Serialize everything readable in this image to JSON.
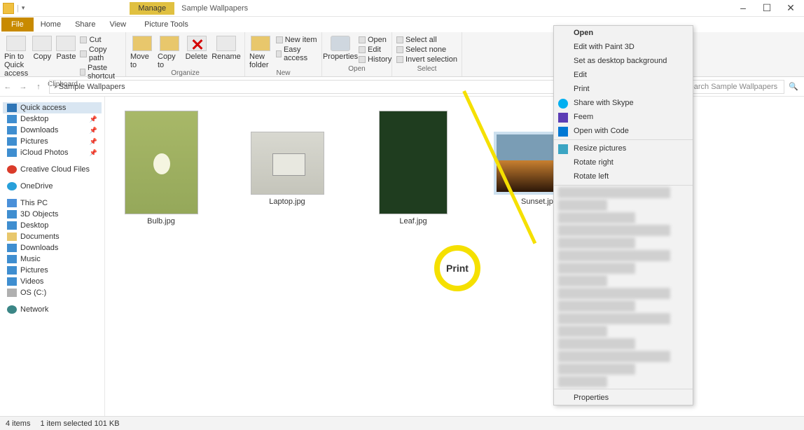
{
  "window": {
    "title_tab": "Manage",
    "title": "Sample Wallpapers",
    "min": "–",
    "max": "☐",
    "close": "✕"
  },
  "tabs": {
    "file": "File",
    "home": "Home",
    "share": "Share",
    "view": "View",
    "picture_tools": "Picture Tools"
  },
  "ribbon": {
    "pin": "Pin to Quick access",
    "copy": "Copy",
    "paste": "Paste",
    "cut": "Cut",
    "copypath": "Copy path",
    "pasteshortcut": "Paste shortcut",
    "clipboard_label": "Clipboard",
    "moveto": "Move to",
    "copyto": "Copy to",
    "delete": "Delete",
    "rename": "Rename",
    "organize_label": "Organize",
    "newfolder": "New folder",
    "newitem": "New item",
    "easyaccess": "Easy access",
    "new_label": "New",
    "properties": "Properties",
    "open": "Open",
    "edit": "Edit",
    "history": "History",
    "open_label": "Open",
    "selectall": "Select all",
    "selectnone": "Select none",
    "invert": "Invert selection",
    "select_label": "Select"
  },
  "address": {
    "back": "←",
    "fwd": "→",
    "up": "↑",
    "path": "› Sample Wallpapers",
    "search_placeholder": "Search Sample Wallpapers",
    "search_glyph": "🔍"
  },
  "sidebar": {
    "quick_access": "Quick access",
    "desktop": "Desktop",
    "downloads": "Downloads",
    "pictures": "Pictures",
    "icloud": "iCloud Photos",
    "creative": "Creative Cloud Files",
    "onedrive": "OneDrive",
    "thispc": "This PC",
    "objects3d": "3D Objects",
    "desktop2": "Desktop",
    "documents": "Documents",
    "downloads2": "Downloads",
    "music": "Music",
    "pictures2": "Pictures",
    "videos": "Videos",
    "osc": "OS (C:)",
    "network": "Network",
    "pin": "📌"
  },
  "files": [
    {
      "name": "Bulb.jpg"
    },
    {
      "name": "Laptop.jpg"
    },
    {
      "name": "Leaf.jpg"
    },
    {
      "name": "Sunset.jpg"
    }
  ],
  "context_menu": {
    "open": "Open",
    "edit_paint3d": "Edit with Paint 3D",
    "set_bg": "Set as desktop background",
    "edit": "Edit",
    "print": "Print",
    "skype": "Share with Skype",
    "feem": "Feem",
    "open_code": "Open with Code",
    "resize": "Resize pictures",
    "rotate_right": "Rotate right",
    "rotate_left": "Rotate left",
    "properties": "Properties"
  },
  "callout": "Print",
  "status": {
    "items": "4 items",
    "selected": "1 item selected  101 KB"
  }
}
